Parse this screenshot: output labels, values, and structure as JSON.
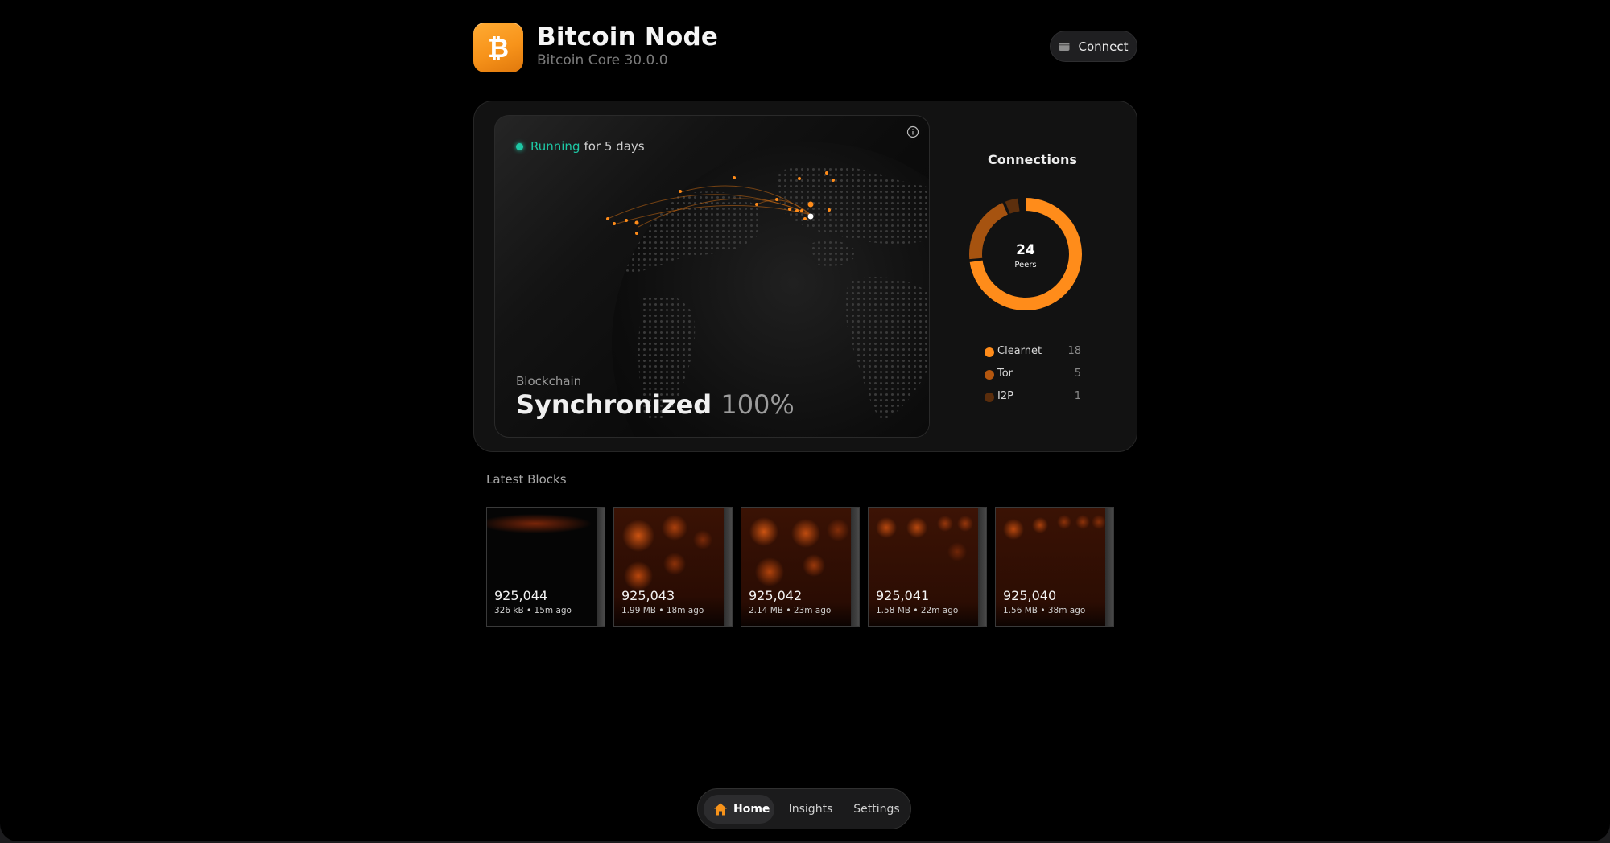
{
  "header": {
    "title": "Bitcoin Node",
    "subtitle": "Bitcoin Core 30.0.0",
    "app_icon": "bitcoin-icon",
    "connect_label": "Connect",
    "connect_icon": "wallet-icon"
  },
  "status": {
    "state": "Running",
    "duration": "for 5 days",
    "color": "#1ec8a5"
  },
  "blockchain": {
    "label": "Blockchain",
    "status": "Synchronized",
    "percent": "100%"
  },
  "connections": {
    "title": "Connections",
    "total": "24",
    "total_label": "Peers",
    "types": [
      {
        "label": "Clearnet",
        "count": "18",
        "color": "#ff8c1a"
      },
      {
        "label": "Tor",
        "count": "5",
        "color": "#b4570f"
      },
      {
        "label": "I2P",
        "count": "1",
        "color": "#5a2d0c"
      }
    ]
  },
  "latest_blocks": {
    "title": "Latest Blocks",
    "blocks": [
      {
        "height": "925,044",
        "meta": "326 kB • 15m ago"
      },
      {
        "height": "925,043",
        "meta": "1.99 MB • 18m ago"
      },
      {
        "height": "925,042",
        "meta": "2.14 MB • 23m ago"
      },
      {
        "height": "925,041",
        "meta": "1.58 MB • 22m ago"
      },
      {
        "height": "925,040",
        "meta": "1.56 MB • 38m ago"
      }
    ]
  },
  "nav": {
    "home": "Home",
    "insights": "Insights",
    "settings": "Settings",
    "active": "Home"
  },
  "colors": {
    "accent": "#f7931a",
    "background": "#000000"
  }
}
